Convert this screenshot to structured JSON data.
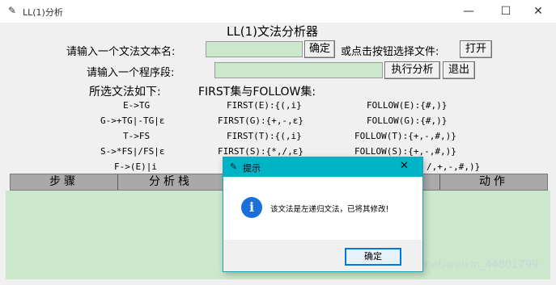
{
  "window": {
    "title": "LL(1)分析",
    "icon": "feather-icon",
    "controls": {
      "minimize": "—",
      "maximize": "☐",
      "close": "✕"
    }
  },
  "header": {
    "title": "LL(1)文法分析器"
  },
  "file_row": {
    "prompt": "请输入一个文法文本名:",
    "input_value": "",
    "confirm_label": "确定",
    "or_text": "或点击按钮选择文件:",
    "open_label": "打开"
  },
  "program_row": {
    "prompt": "请输入一个程序段:",
    "input_value": "",
    "execute_label": "执行分析",
    "exit_label": "退出"
  },
  "grammar_section": {
    "heading": "所选文法如下:",
    "first_follow_heading": "FIRST集与FOLLOW集:",
    "rows": [
      {
        "production": "E->TG",
        "first": "FIRST(E):{(,i}",
        "follow": "FOLLOW(E):{#,)}"
      },
      {
        "production": "G->+TG|-TG|ε",
        "first": "FIRST(G):{+,-,ε}",
        "follow": "FOLLOW(G):{#,)}"
      },
      {
        "production": "T->FS",
        "first": "FIRST(T):{(,i}",
        "follow": "FOLLOW(T):{+,-,#,)}"
      },
      {
        "production": "S->*FS|/FS|ε",
        "first": "FIRST(S):{*,/,ε}",
        "follow": "FOLLOW(S):{+,-,#,)}"
      },
      {
        "production": "F->(E)|i",
        "first": "",
        "follow": "/,+,-,#,)}"
      }
    ]
  },
  "table": {
    "columns": [
      "步骤",
      "分析栈",
      "入",
      "动作"
    ]
  },
  "dialog": {
    "title": "提示",
    "icon": "feather-icon",
    "close": "✕",
    "info_icon": "i",
    "message": "该文法是左递归文法，已将其修改!",
    "ok_label": "确定"
  },
  "watermark": "https://blog.csdn.net/weixin_44801799",
  "colors": {
    "entry_bg": "#cce8cc",
    "dialog_title_bg": "#00b4c8",
    "info_blue": "#1a6fd8",
    "table_header_bg": "#a9a9a9"
  }
}
